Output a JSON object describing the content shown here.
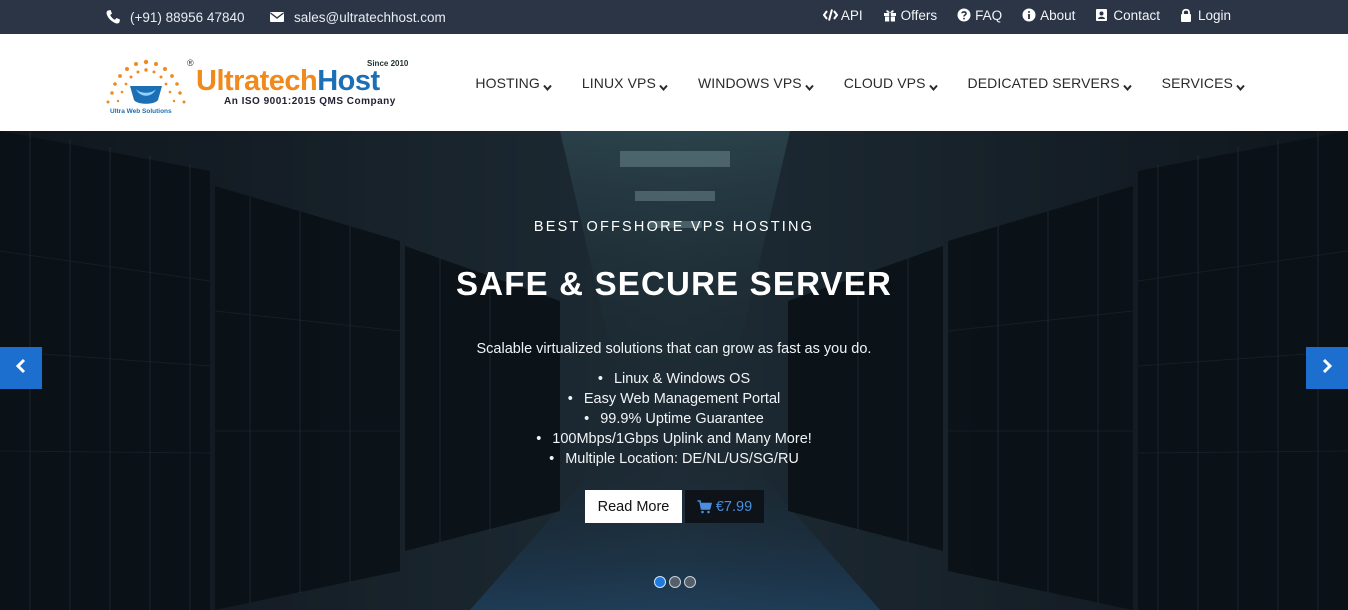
{
  "topbar": {
    "phone": "(+91) 88956 47840",
    "email": "sales@ultratechhost.com",
    "links": [
      {
        "label": "API",
        "icon": "code-icon"
      },
      {
        "label": "Offers",
        "icon": "gift-icon"
      },
      {
        "label": "FAQ",
        "icon": "question-circle-icon"
      },
      {
        "label": "About",
        "icon": "info-circle-icon"
      },
      {
        "label": "Contact",
        "icon": "contact-card-icon"
      },
      {
        "label": "Login",
        "icon": "lock-icon"
      }
    ]
  },
  "logo": {
    "brand_a": "Ultratech",
    "brand_b": "Host",
    "since": "Since 2010",
    "tagline": "An ISO 9001:2015 QMS Company",
    "sub": "Ultra Web Solutions",
    "reg": "®"
  },
  "nav": {
    "items": [
      {
        "label": "HOSTING"
      },
      {
        "label": "LINUX VPS"
      },
      {
        "label": "WINDOWS VPS"
      },
      {
        "label": "CLOUD VPS"
      },
      {
        "label": "DEDICATED SERVERS"
      },
      {
        "label": "SERVICES"
      }
    ]
  },
  "hero": {
    "eyebrow": "BEST OFFSHORE VPS HOSTING",
    "headline": "SAFE & SECURE SERVER",
    "lead": "Scalable virtualized solutions that can grow as fast as you do.",
    "features": [
      "Linux & Windows OS",
      "Easy Web Management Portal",
      "99.9% Uptime Guarantee",
      "100Mbps/1Gbps Uplink and Many More!",
      "Multiple Location: DE/NL/US/SG/RU"
    ],
    "read_more": "Read More",
    "price": "€7.99",
    "slides": 3,
    "active_slide": 1
  },
  "colors": {
    "topbar_bg": "#2b3545",
    "accent_blue": "#1c6fcf",
    "brand_orange": "#f08a1c",
    "brand_blue": "#1c6fb5"
  }
}
